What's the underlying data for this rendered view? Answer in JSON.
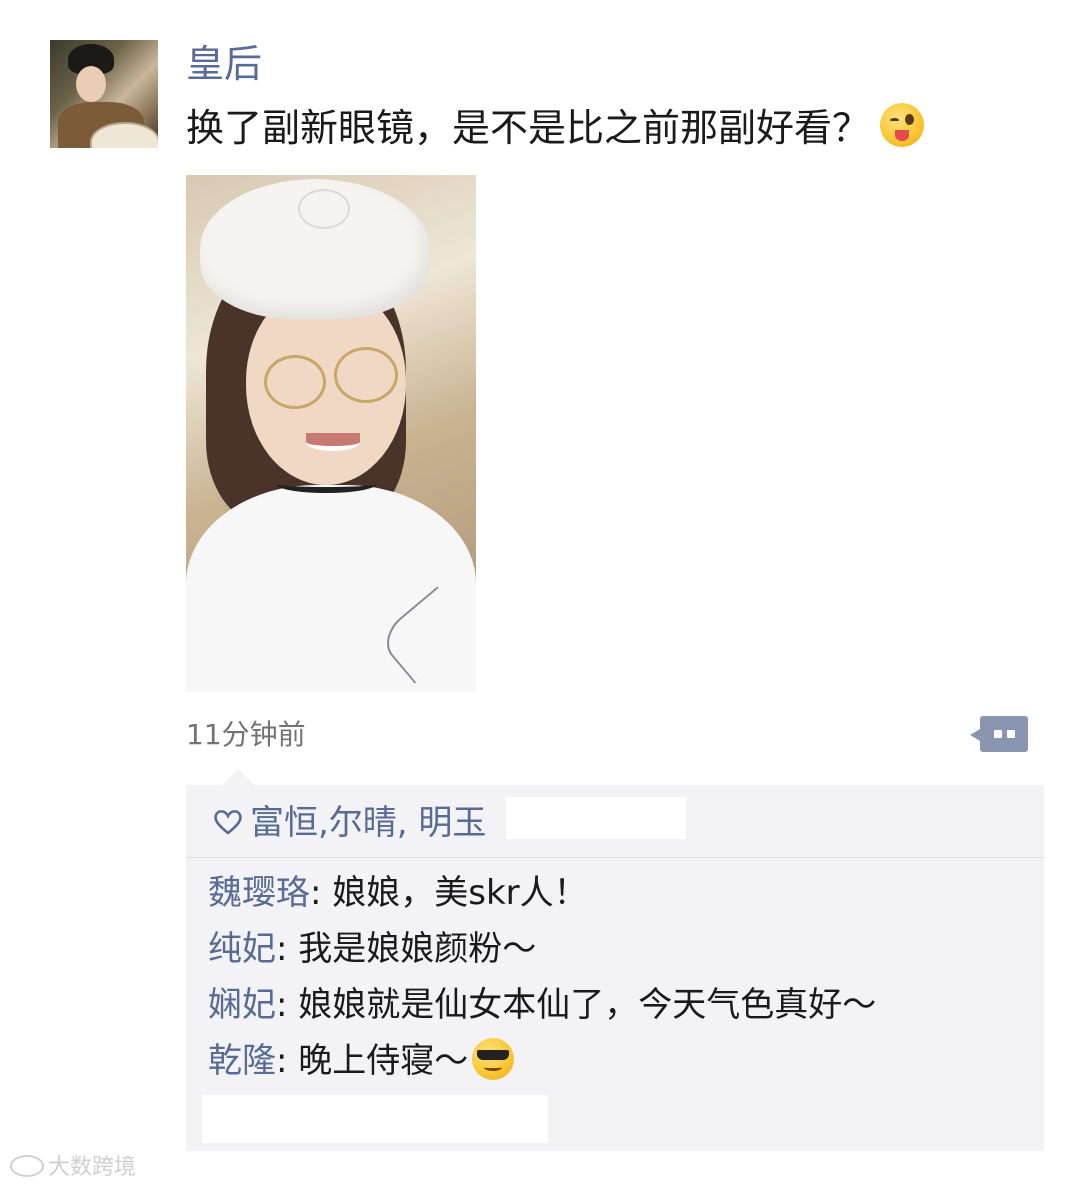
{
  "post": {
    "author": "皇后",
    "text": "换了副新眼镜，是不是比之前那副好看？",
    "text_emoji": "wink-tongue-emoji",
    "photo_icon": "selfie-photo",
    "timestamp": "11分钟前"
  },
  "likes": {
    "names": "富恒,尔晴, 明玉"
  },
  "comments": [
    {
      "author": "魏璎珞",
      "separator": ": ",
      "text": "娘娘，美skr人！"
    },
    {
      "author": "纯妃",
      "separator": ": ",
      "text": "我是娘娘颜粉～"
    },
    {
      "author": "娴妃",
      "separator": ": ",
      "text": "娘娘就是仙女本仙了，今天气色真好～"
    },
    {
      "author": "乾隆",
      "separator": ": ",
      "text": "晚上侍寝～",
      "emoji": "sunglasses-emoji"
    }
  ],
  "watermark": {
    "text": "大数跨境"
  },
  "colors": {
    "name_link": "#576b95",
    "body_text": "#1a1a1a",
    "meta_text": "#737373",
    "interaction_bg": "#f3f3f5",
    "comment_button": "#8a96b0"
  }
}
